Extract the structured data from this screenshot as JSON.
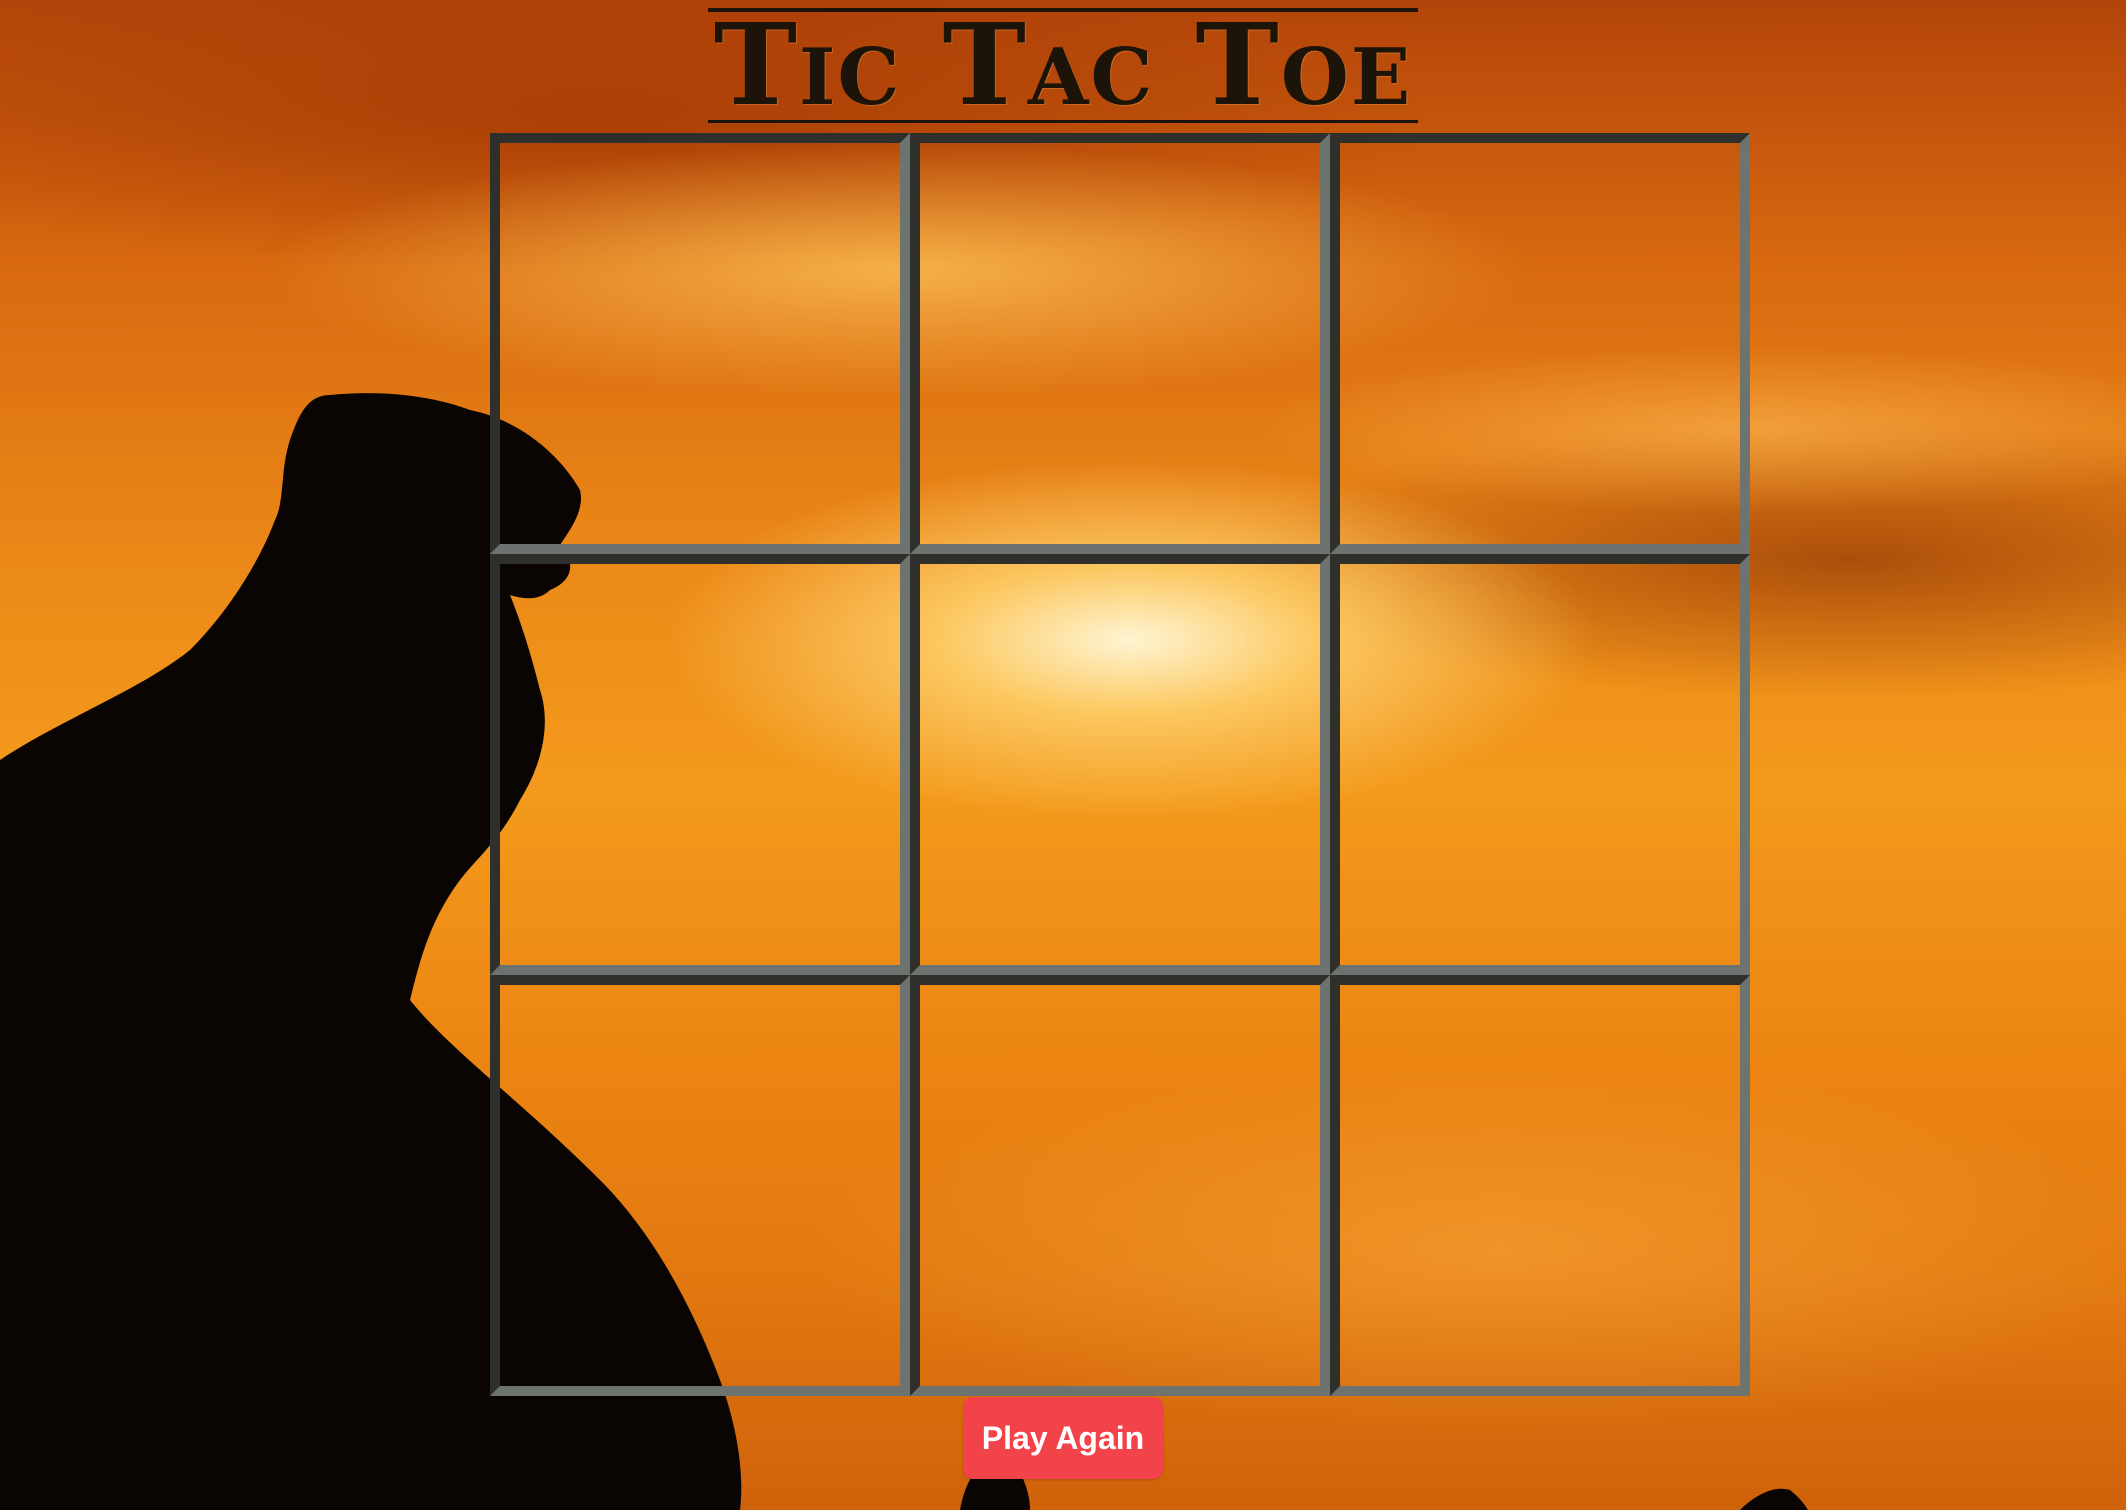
{
  "game": {
    "title": "Tic Tac Toe",
    "board": {
      "cells": [
        "",
        "",
        "",
        "",
        "",
        "",
        "",
        "",
        ""
      ]
    },
    "play_again_label": "Play Again"
  },
  "colors": {
    "button_background": "#f2424a",
    "button_text": "#ffffff",
    "grid_dark": "#2f302c",
    "grid_light": "#6d736e",
    "title_ink": "#1c1408"
  },
  "background": {
    "description_icon": "sunset-eagle-silhouette"
  }
}
